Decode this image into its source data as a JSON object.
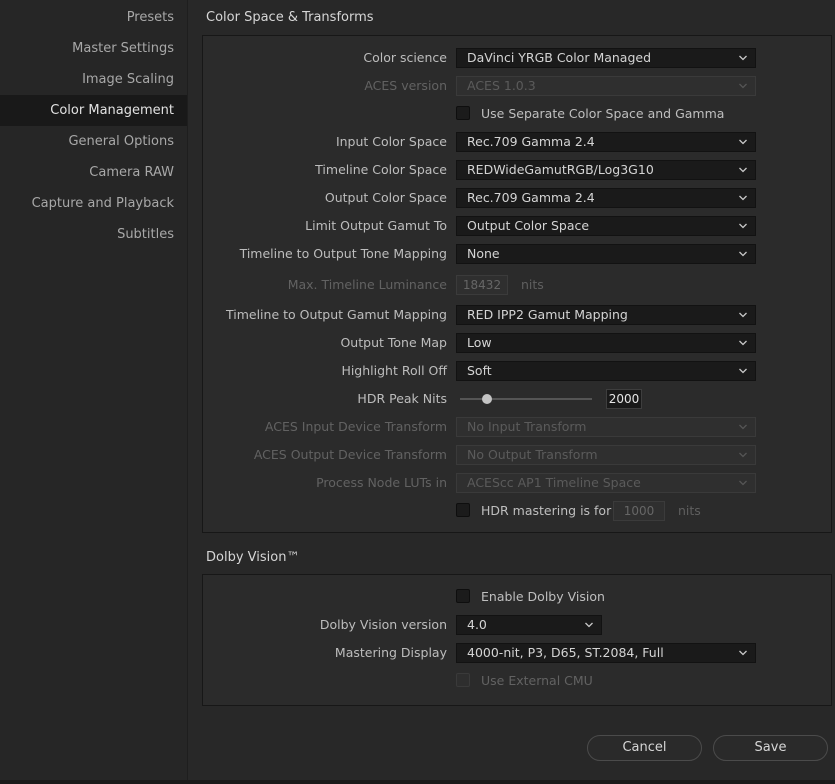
{
  "sidebar": {
    "items": [
      {
        "label": "Presets",
        "active": false
      },
      {
        "label": "Master Settings",
        "active": false
      },
      {
        "label": "Image Scaling",
        "active": false
      },
      {
        "label": "Color Management",
        "active": true
      },
      {
        "label": "General Options",
        "active": false
      },
      {
        "label": "Camera RAW",
        "active": false
      },
      {
        "label": "Capture and Playback",
        "active": false
      },
      {
        "label": "Subtitles",
        "active": false
      }
    ]
  },
  "color_space": {
    "title": "Color Space & Transforms",
    "color_science": {
      "label": "Color science",
      "value": "DaVinci YRGB Color Managed"
    },
    "aces_version": {
      "label": "ACES version",
      "value": "ACES 1.0.3",
      "enabled": false
    },
    "separate_gamma": {
      "label": "Use Separate Color Space and Gamma",
      "checked": false
    },
    "input_color_space": {
      "label": "Input Color Space",
      "value": "Rec.709 Gamma 2.4"
    },
    "timeline_color_space": {
      "label": "Timeline Color Space",
      "value": "REDWideGamutRGB/Log3G10"
    },
    "output_color_space": {
      "label": "Output Color Space",
      "value": "Rec.709 Gamma 2.4"
    },
    "limit_output_gamut": {
      "label": "Limit Output Gamut To",
      "value": "Output Color Space"
    },
    "tone_mapping": {
      "label": "Timeline to Output Tone Mapping",
      "value": "None"
    },
    "max_luminance": {
      "label": "Max. Timeline Luminance",
      "value": "18432",
      "unit": "nits",
      "enabled": false
    },
    "gamut_mapping": {
      "label": "Timeline to Output Gamut Mapping",
      "value": "RED IPP2 Gamut Mapping"
    },
    "output_tone_map": {
      "label": "Output Tone Map",
      "value": "Low"
    },
    "highlight_roll_off": {
      "label": "Highlight Roll Off",
      "value": "Soft"
    },
    "hdr_peak_nits": {
      "label": "HDR Peak Nits",
      "value": "2000"
    },
    "aces_idt": {
      "label": "ACES Input Device Transform",
      "value": "No Input Transform",
      "enabled": false
    },
    "aces_odt": {
      "label": "ACES Output Device Transform",
      "value": "No Output Transform",
      "enabled": false
    },
    "process_luts": {
      "label": "Process Node LUTs in",
      "value": "ACEScc AP1 Timeline Space",
      "enabled": false
    },
    "hdr_mastering": {
      "label": "HDR mastering is for",
      "value": "1000",
      "unit": "nits",
      "checked": false
    }
  },
  "dolby": {
    "title": "Dolby Vision™",
    "enable": {
      "label": "Enable Dolby Vision",
      "checked": false
    },
    "version": {
      "label": "Dolby Vision version",
      "value": "4.0"
    },
    "mastering_display": {
      "label": "Mastering Display",
      "value": "4000-nit, P3, D65, ST.2084, Full"
    },
    "external_cmu": {
      "label": "Use External CMU",
      "checked": false,
      "enabled": false
    }
  },
  "buttons": {
    "cancel": "Cancel",
    "save": "Save"
  },
  "icons": {
    "dropdown": "chevron-down-icon"
  },
  "colors": {
    "background": "#282828",
    "panel": "#2b2b2b",
    "selected_sidebar": "#191919"
  }
}
